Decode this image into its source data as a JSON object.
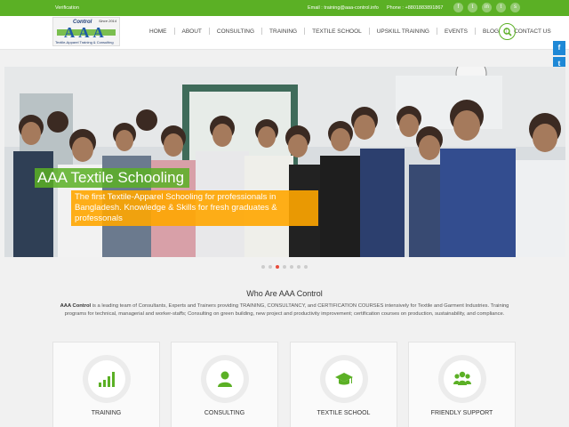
{
  "topbar": {
    "verification": "Verification",
    "email": "Email : training@aaa-control.info",
    "phone": "Phone : +8801883891867",
    "socials": [
      "f",
      "t",
      "in",
      "t",
      "s"
    ]
  },
  "logo": {
    "since": "Since 2014",
    "control": "Control",
    "aaa": "AAA",
    "tagline": "Textile-Apparel Training & Consulting"
  },
  "nav": {
    "items": [
      "HOME",
      "ABOUT",
      "CONSULTING",
      "TRAINING",
      "TEXTILE SCHOOL",
      "UPSKILL TRAINING",
      "EVENTS",
      "BLOG",
      "CONTACT US"
    ]
  },
  "share": {
    "buttons": [
      "f",
      "t",
      "✉",
      "+"
    ]
  },
  "hero": {
    "title": "AAA Textile Schooling",
    "subtitle": "The first Textile-Apparel Schooling for professionals in Bangladesh. Knowledge & Skills for fresh graduates & professonals"
  },
  "about": {
    "title": "Who Are AAA Control",
    "brand": "AAA Control",
    "text": " is a leading team of Consultants, Experts and Trainers providing TRAINING, CONSULTANCY, and CERTIFICATION COURSES intensively for Textile and Garment Industries. Training programs for technical, managerial and worker-staffs; Consulting on green building, new project and productivity improvement; certification courses on production, sustainability, and compliance."
  },
  "cards": [
    {
      "label": "TRAINING",
      "icon": "bar-chart-icon"
    },
    {
      "label": "CONSULTING",
      "icon": "user-icon"
    },
    {
      "label": "TEXTILE SCHOOL",
      "icon": "graduation-cap-icon"
    },
    {
      "label": "FRIENDLY SUPPORT",
      "icon": "users-icon"
    }
  ],
  "colors": {
    "brand_green": "#5bb025",
    "accent_orange": "#ffa600",
    "share_blue": "#1e88d6"
  }
}
